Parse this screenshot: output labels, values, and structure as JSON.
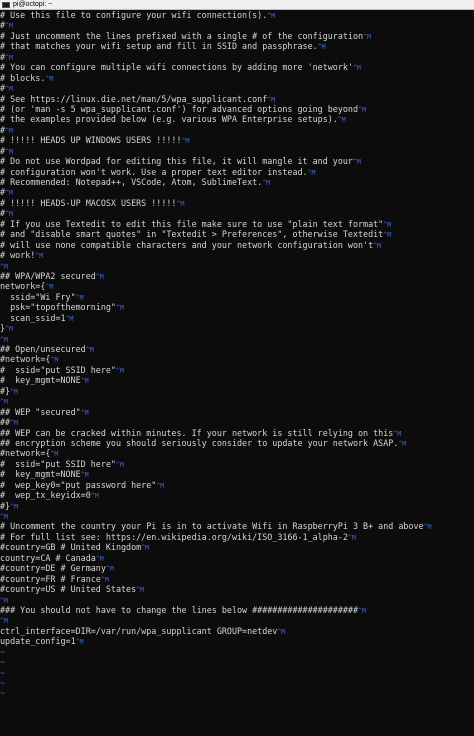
{
  "window": {
    "title": "pi@octopi: ~"
  },
  "lines": [
    {
      "t": "# Use this file to configure your wifi connection(s).",
      "cr": true
    },
    {
      "t": "#",
      "cr": true
    },
    {
      "t": "# Just uncomment the lines prefixed with a single # of the configuration",
      "cr": true
    },
    {
      "t": "# that matches your wifi setup and fill in SSID and passphrase.",
      "cr": true
    },
    {
      "t": "#",
      "cr": true
    },
    {
      "t": "# You can configure multiple wifi connections by adding more 'network'",
      "cr": true
    },
    {
      "t": "# blocks.",
      "cr": true
    },
    {
      "t": "#",
      "cr": true
    },
    {
      "t": "# See https://linux.die.net/man/5/wpa_supplicant.conf",
      "cr": true
    },
    {
      "t": "# (or 'man -s 5 wpa_supplicant.conf') for advanced options going beyond",
      "cr": true
    },
    {
      "t": "# the examples provided below (e.g. various WPA Enterprise setups).",
      "cr": true
    },
    {
      "t": "#",
      "cr": true
    },
    {
      "t": "# !!!!! HEADS UP WINDOWS USERS !!!!!",
      "cr": true
    },
    {
      "t": "#",
      "cr": true
    },
    {
      "t": "# Do not use Wordpad for editing this file, it will mangle it and your",
      "cr": true
    },
    {
      "t": "# configuration won't work. Use a proper text editor instead.",
      "cr": true
    },
    {
      "t": "# Recommended: Notepad++, VSCode, Atom, SublimeText.",
      "cr": true
    },
    {
      "t": "#",
      "cr": true
    },
    {
      "t": "# !!!!! HEADS-UP MACOSX USERS !!!!!",
      "cr": true
    },
    {
      "t": "#",
      "cr": true
    },
    {
      "t": "# If you use Textedit to edit this file make sure to use \"plain text format\"",
      "cr": true
    },
    {
      "t": "# and \"disable smart quotes\" in \"Textedit > Preferences\", otherwise Textedit",
      "cr": true
    },
    {
      "t": "# will use none compatible characters and your network configuration won't",
      "cr": true
    },
    {
      "t": "# work!",
      "cr": true
    },
    {
      "t": "",
      "cr": true
    },
    {
      "t": "## WPA/WPA2 secured",
      "cr": true
    },
    {
      "t": "network={",
      "cr": true
    },
    {
      "t": "  ssid=\"Wi Fry\"",
      "cr": true
    },
    {
      "t": "  psk=\"topofthemorning\"",
      "cr": true
    },
    {
      "t": "  scan_ssid=1",
      "cr": true
    },
    {
      "t": "}",
      "cr": true
    },
    {
      "t": "",
      "cr": true
    },
    {
      "t": "## Open/unsecured",
      "cr": true
    },
    {
      "t": "#network={",
      "cr": true
    },
    {
      "t": "#  ssid=\"put SSID here\"",
      "cr": true
    },
    {
      "t": "#  key_mgmt=NONE",
      "cr": true
    },
    {
      "t": "#}",
      "cr": true
    },
    {
      "t": "",
      "cr": true
    },
    {
      "t": "## WEP \"secured\"",
      "cr": true
    },
    {
      "t": "##",
      "cr": true
    },
    {
      "t": "## WEP can be cracked within minutes. If your network is still relying on this",
      "cr": true
    },
    {
      "t": "## encryption scheme you should seriously consider to update your network ASAP.",
      "cr": true
    },
    {
      "t": "#network={",
      "cr": true
    },
    {
      "t": "#  ssid=\"put SSID here\"",
      "cr": true
    },
    {
      "t": "#  key_mgmt=NONE",
      "cr": true
    },
    {
      "t": "#  wep_key0=\"put password here\"",
      "cr": true
    },
    {
      "t": "#  wep_tx_keyidx=0",
      "cr": true
    },
    {
      "t": "#}",
      "cr": true
    },
    {
      "t": "",
      "cr": true
    },
    {
      "t": "# Uncomment the country your Pi is in to activate Wifi in RaspberryPi 3 B+ and above",
      "cr": true
    },
    {
      "t": "# For full list see: https://en.wikipedia.org/wiki/ISO_3166-1_alpha-2",
      "cr": true
    },
    {
      "t": "#country=GB # United Kingdom",
      "cr": true
    },
    {
      "t": "country=CA # Canada",
      "cr": true
    },
    {
      "t": "#country=DE # Germany",
      "cr": true
    },
    {
      "t": "#country=FR # France",
      "cr": true
    },
    {
      "t": "#country=US # United States",
      "cr": true
    },
    {
      "t": "",
      "cr": true
    },
    {
      "t": "### You should not have to change the lines below #####################",
      "cr": true
    },
    {
      "t": "",
      "cr": true
    },
    {
      "t": "ctrl_interface=DIR=/var/run/wpa_supplicant GROUP=netdev",
      "cr": true
    },
    {
      "t": "update_config=1",
      "cr": true
    },
    {
      "t": "~",
      "tilde": true
    },
    {
      "t": "~",
      "tilde": true
    },
    {
      "t": "~",
      "tilde": true
    },
    {
      "t": "~",
      "tilde": true
    },
    {
      "t": "~",
      "tilde": true
    }
  ],
  "cr_marker": "^M",
  "colors": {
    "text": "#d6d6d6",
    "marker": "#3f63c8",
    "background": "#0c0c0c"
  }
}
